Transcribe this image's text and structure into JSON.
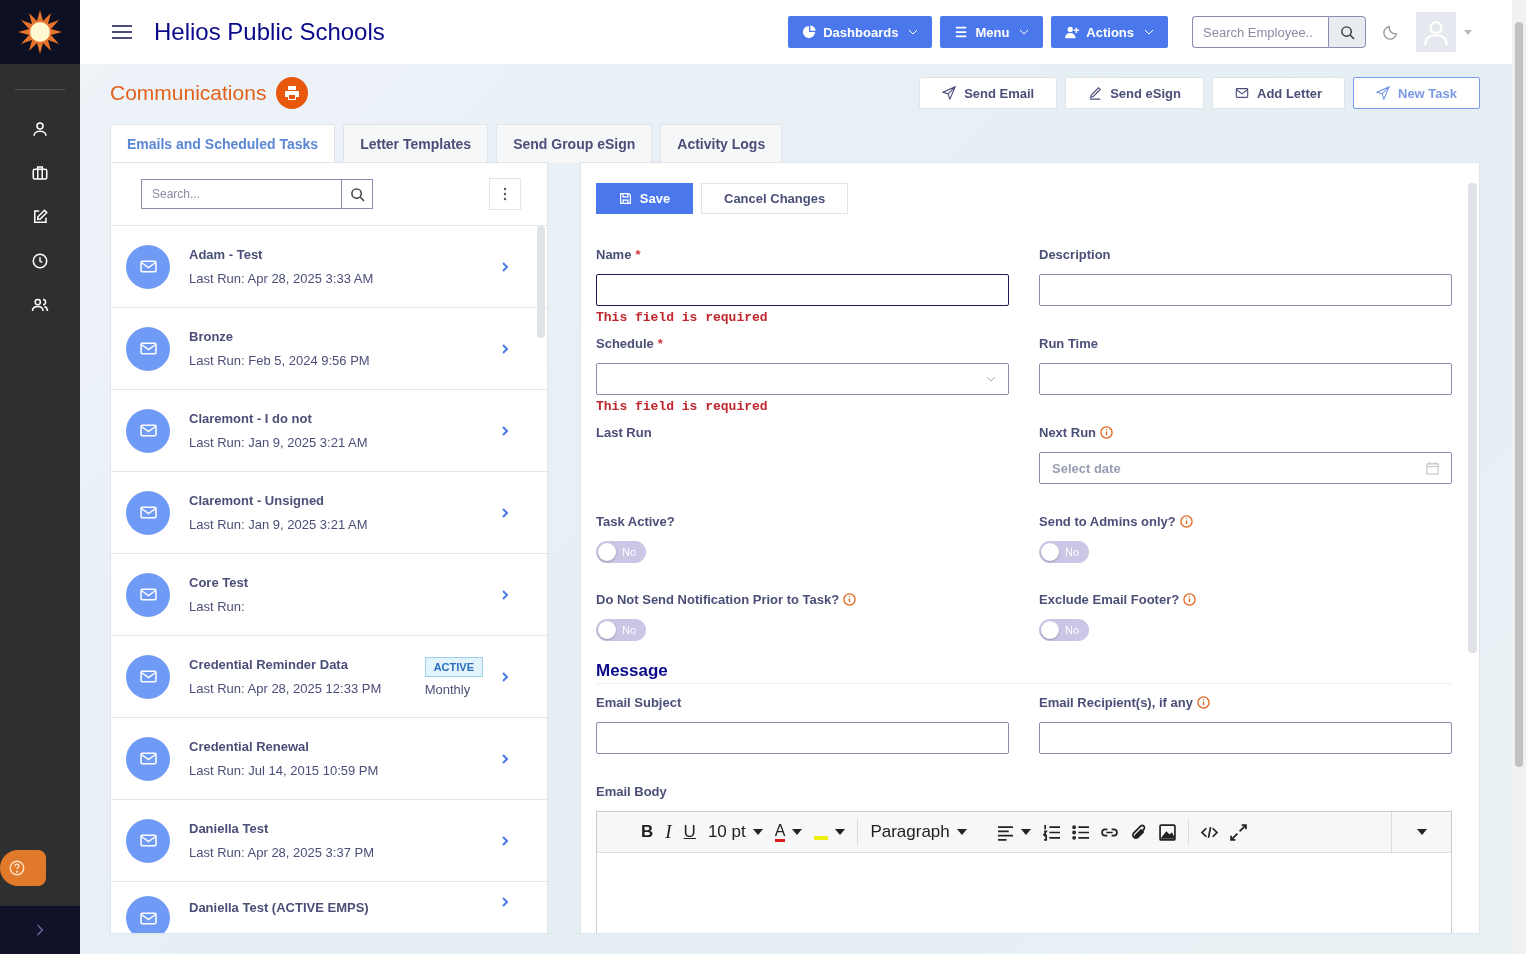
{
  "header": {
    "title": "Helios Public Schools",
    "menus": [
      {
        "label": "Dashboards"
      },
      {
        "label": "Menu"
      },
      {
        "label": "Actions"
      }
    ],
    "search": {
      "placeholder": "Search Employee.."
    }
  },
  "page": {
    "title": "Communications",
    "actions": [
      {
        "label": "Send Email",
        "highlighted": false
      },
      {
        "label": "Send eSign",
        "highlighted": false
      },
      {
        "label": "Add Letter",
        "highlighted": false
      },
      {
        "label": "New Task",
        "highlighted": true
      }
    ]
  },
  "tabs": [
    {
      "label": "Emails and Scheduled Tasks",
      "selected": true
    },
    {
      "label": "Letter Templates",
      "selected": false
    },
    {
      "label": "Send Group eSign",
      "selected": false
    },
    {
      "label": "Activity Logs",
      "selected": false
    }
  ],
  "list": {
    "search": {
      "placeholder": "Search..."
    },
    "items": [
      {
        "title": "Adam - Test",
        "subtitle": "Last Run: Apr 28, 2025 3:33 AM"
      },
      {
        "title": "Bronze",
        "subtitle": "Last Run: Feb 5, 2024 9:56 PM"
      },
      {
        "title": "Claremont - I do not",
        "subtitle": "Last Run: Jan 9, 2025 3:21 AM"
      },
      {
        "title": "Claremont - Unsigned",
        "subtitle": "Last Run: Jan 9, 2025 3:21 AM"
      },
      {
        "title": "Core Test",
        "subtitle": "Last Run:"
      },
      {
        "title": "Credential Reminder Data",
        "subtitle": "Last Run: Apr 28, 2025 12:33 PM",
        "badge": "ACTIVE",
        "frequency": "Monthly"
      },
      {
        "title": "Credential Renewal",
        "subtitle": "Last Run: Jul 14, 2015 10:59 PM"
      },
      {
        "title": "Daniella Test",
        "subtitle": "Last Run: Apr 28, 2025 3:37 PM"
      },
      {
        "title": "Daniella Test (ACTIVE EMPS)"
      }
    ]
  },
  "form": {
    "buttons": {
      "save": "Save",
      "cancel": "Cancel Changes"
    },
    "fields": [
      {
        "kind": "text",
        "label": "Name",
        "required_mark": "*",
        "focused": true,
        "error": "This field is required"
      },
      {
        "kind": "text",
        "label": "Description",
        "focused": false
      },
      {
        "kind": "select",
        "label": "Schedule",
        "required_mark": "*",
        "focused": false,
        "error": "This field is required"
      },
      {
        "kind": "text",
        "label": "Run Time",
        "focused": false
      },
      {
        "kind": "static",
        "label": "Last Run"
      },
      {
        "kind": "date",
        "label": "Next Run",
        "info": true,
        "placeholder": "Select date"
      },
      {
        "kind": "toggle",
        "label": "Task Active?",
        "on": false,
        "state_text": "No"
      },
      {
        "kind": "toggle",
        "label": "Send to Admins only?",
        "info": true,
        "on": false,
        "state_text": "No"
      },
      {
        "kind": "toggle",
        "label": "Do Not Send Notification Prior to Task?",
        "info": true,
        "on": false,
        "state_text": "No"
      },
      {
        "kind": "toggle",
        "label": "Exclude Email Footer?",
        "info": true,
        "on": false,
        "state_text": "No"
      }
    ],
    "message": {
      "heading": "Message",
      "fields": [
        {
          "label": "Email Subject",
          "focused": false
        },
        {
          "label": "Email Recipient(s), if any",
          "focused": false,
          "info": true
        }
      ],
      "body": {
        "label": "Email Body",
        "format_buttons": [
          "B",
          "I",
          "U"
        ],
        "font_size": "10 pt",
        "text_color": "A",
        "block_format": "Paragraph"
      }
    }
  }
}
